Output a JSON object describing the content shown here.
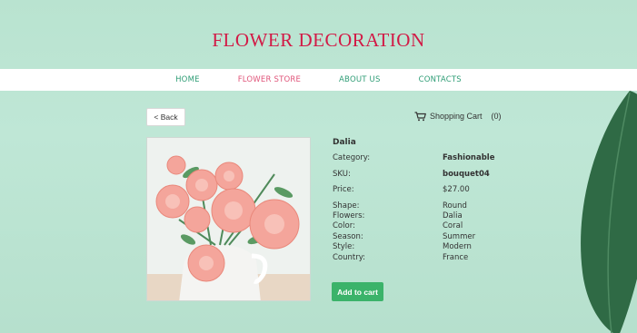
{
  "site": {
    "title": "FLOWER DECORATION"
  },
  "nav": {
    "items": [
      {
        "label": "HOME",
        "active": false
      },
      {
        "label": "FLOWER STORE",
        "active": true
      },
      {
        "label": "ABOUT US",
        "active": false
      },
      {
        "label": "CONTACTS",
        "active": false
      }
    ]
  },
  "toolbar": {
    "back_label": "< Back",
    "cart_label": "Shopping Cart",
    "cart_count": "(0)",
    "cart_icon": "shopping-cart-icon"
  },
  "product": {
    "name": "Dalia",
    "image_icon": "pink-dahlia-bouquet-photo",
    "rows": [
      {
        "key": "Category:",
        "value": "Fashionable",
        "bold": true
      },
      {
        "key": "SKU:",
        "value": "bouquet04",
        "bold": true
      },
      {
        "key": "Price:",
        "value": "$27.00",
        "bold": false
      }
    ],
    "specs": [
      {
        "key": "Shape:",
        "value": "Round"
      },
      {
        "key": "Flowers:",
        "value": "Dalia"
      },
      {
        "key": "Color:",
        "value": "Coral"
      },
      {
        "key": "Season:",
        "value": "Summer"
      },
      {
        "key": "Style:",
        "value": "Modern"
      },
      {
        "key": "Country:",
        "value": "France"
      }
    ],
    "add_to_cart_label": "Add to cart"
  },
  "colors": {
    "background": "#bfe7d6",
    "title": "#d21a46",
    "nav_link": "#2f9d76",
    "nav_active": "#e0557a",
    "button_green": "#3bb36a"
  }
}
